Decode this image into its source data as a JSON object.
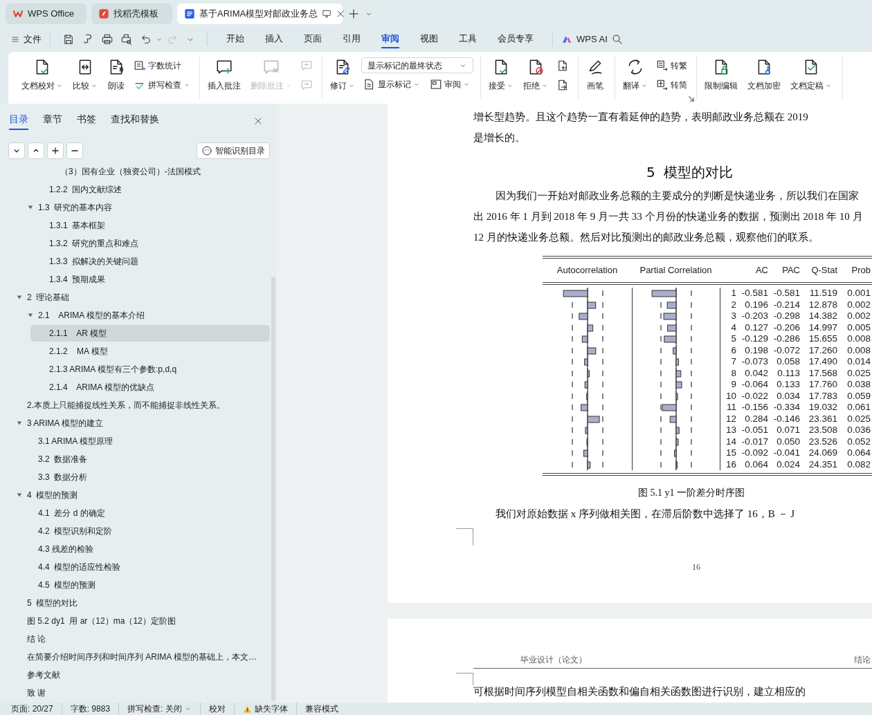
{
  "tabs": [
    {
      "label": "WPS Office",
      "kind": "wps",
      "selected": false
    },
    {
      "label": "找稻壳模板",
      "kind": "docer",
      "selected": false
    },
    {
      "label": "基于ARIMA模型对邮政业务总",
      "kind": "doc",
      "selected": true
    }
  ],
  "file_menu": {
    "label": "文件"
  },
  "quick_actions": [
    {
      "disabled": false
    },
    {
      "disabled": false
    },
    {
      "disabled": false
    },
    {
      "disabled": false
    },
    {
      "disabled": false
    },
    {
      "disabled": true
    }
  ],
  "menu_tabs": [
    {
      "label": "开始",
      "selected": false
    },
    {
      "label": "插入",
      "selected": false
    },
    {
      "label": "页面",
      "selected": false
    },
    {
      "label": "引用",
      "selected": false
    },
    {
      "label": "审阅",
      "selected": true
    },
    {
      "label": "视图",
      "selected": false
    },
    {
      "label": "工具",
      "selected": false
    },
    {
      "label": "会员专享",
      "selected": false
    }
  ],
  "ai_button": {
    "label": "WPS AI"
  },
  "ribbon": {
    "groups": [
      {
        "items": [
          {
            "kind": "large",
            "label": "文档校对",
            "caret": true,
            "disabled": false
          },
          {
            "kind": "large",
            "label": "比较",
            "caret": true,
            "disabled": false
          },
          {
            "kind": "large",
            "label": "朗读",
            "caret": false,
            "disabled": false
          },
          {
            "kind": "stack",
            "rows": [
              [
                {
                  "kind": "button",
                  "label": "字数统计",
                  "caret": false,
                  "disabled": false
                }
              ],
              [
                {
                  "kind": "button",
                  "label": "拼写检查",
                  "caret": true,
                  "disabled": false
                }
              ]
            ]
          }
        ]
      },
      {
        "items": [
          {
            "kind": "large",
            "label": "插入批注",
            "caret": false,
            "disabled": false
          },
          {
            "kind": "large",
            "label": "删除批注",
            "caret": true,
            "disabled": true
          },
          {
            "kind": "stack",
            "rows": [
              [
                {
                  "kind": "button",
                  "caret": false,
                  "disabled": true
                }
              ],
              [
                {
                  "kind": "button",
                  "caret": false,
                  "disabled": true
                }
              ]
            ]
          }
        ]
      },
      {
        "items": [
          {
            "kind": "large",
            "label": "修订",
            "caret": true,
            "disabled": false
          },
          {
            "kind": "stack",
            "rows": [
              [
                {
                  "kind": "select",
                  "value": "显示标记的最终状态"
                }
              ],
              [
                {
                  "kind": "button",
                  "label": "显示标记",
                  "caret": true,
                  "disabled": false
                },
                {
                  "kind": "button",
                  "label": "审阅",
                  "caret": true,
                  "disabled": false
                }
              ]
            ]
          }
        ]
      },
      {
        "items": [
          {
            "kind": "large",
            "label": "接受",
            "caret": true,
            "disabled": false
          },
          {
            "kind": "large",
            "label": "拒绝",
            "caret": true,
            "disabled": false
          },
          {
            "kind": "stack",
            "rows": [
              [
                {
                  "kind": "button",
                  "caret": false,
                  "disabled": false
                }
              ],
              [
                {
                  "kind": "button",
                  "caret": false,
                  "disabled": false
                }
              ]
            ]
          }
        ]
      },
      {
        "items": [
          {
            "kind": "large",
            "label": "画笔",
            "caret": false,
            "disabled": false
          }
        ]
      },
      {
        "items": [
          {
            "kind": "large",
            "label": "翻译",
            "caret": true,
            "disabled": false
          },
          {
            "kind": "stack",
            "rows": [
              [
                {
                  "kind": "button",
                  "label": "转繁",
                  "caret": false,
                  "disabled": false
                }
              ],
              [
                {
                  "kind": "button",
                  "label": "转简",
                  "caret": false,
                  "disabled": false
                }
              ]
            ]
          },
          {
            "kind": "launcher"
          }
        ]
      },
      {
        "items": [
          {
            "kind": "large",
            "label": "限制编辑",
            "caret": false,
            "disabled": false
          },
          {
            "kind": "large",
            "label": "文档加密",
            "caret": false,
            "disabled": false
          },
          {
            "kind": "large",
            "label": "文档定稿",
            "caret": true,
            "disabled": false
          }
        ]
      }
    ]
  },
  "sidebar": {
    "tabs": [
      {
        "label": "目录",
        "selected": true
      },
      {
        "label": "章节",
        "selected": false
      },
      {
        "label": "书签",
        "selected": false
      },
      {
        "label": "查找和替换",
        "selected": false
      }
    ],
    "smart_button": {
      "label": "智能识别目录"
    },
    "outline": [
      {
        "children": [
          {
            "children": [
              {
                "children": [
                  {
                    "label": "（3）国有企业（独资公司）-法国模式",
                    "selected": false
                  }
                ]
              },
              {
                "label": "1.2.2  国内文献综述",
                "selected": false
              }
            ]
          },
          {
            "label": "1.3  研究的基本内容",
            "selected": false,
            "expanded": true,
            "children": [
              {
                "label": "1.3.1  基本框架",
                "selected": false
              },
              {
                "label": "1.3.2  研究的重点和难点",
                "selected": false
              },
              {
                "label": "1.3.3  拟解决的关键问题",
                "selected": false
              },
              {
                "label": "1.3.4  预期成果",
                "selected": false
              }
            ]
          }
        ]
      },
      {
        "label": "2  理论基础",
        "selected": false,
        "expanded": true,
        "children": [
          {
            "label": "2.1    ARIMA 模型的基本介绍",
            "selected": false,
            "expanded": true,
            "children": [
              {
                "label": "2.1.1    AR 模型",
                "selected": true
              },
              {
                "label": "2.1.2    MA 模型",
                "selected": false
              },
              {
                "label": "2.1.3 ARIMA 模型有三个参数:p,d,q",
                "selected": false
              },
              {
                "label": "2.1.4    ARIMA 模型的优缺点",
                "selected": false
              }
            ]
          }
        ]
      },
      {
        "label": "2.本质上只能捕捉线性关系，而不能捕捉非线性关系。",
        "selected": false
      },
      {
        "label": "3 ARIMA 模型的建立",
        "selected": false,
        "expanded": true,
        "children": [
          {
            "label": "3.1 ARIMA 模型原理",
            "selected": false
          },
          {
            "label": "3.2  数据准备",
            "selected": false
          },
          {
            "label": "3.3  数据分析",
            "selected": false
          }
        ]
      },
      {
        "label": "4  模型的预测",
        "selected": false,
        "expanded": true,
        "children": [
          {
            "label": "4.1  差分 d 的确定",
            "selected": false
          },
          {
            "label": "4.2  模型识别和定阶",
            "selected": false
          },
          {
            "label": "4.3 残差的检验",
            "selected": false
          },
          {
            "label": "4.4  模型的适应性检验",
            "selected": false
          },
          {
            "label": "4.5  模型的预测",
            "selected": false
          }
        ]
      },
      {
        "label": "5  模型的对比",
        "selected": false
      },
      {
        "label": "图 5.2 dy1  用 ar（12）ma（12）定阶图",
        "selected": false
      },
      {
        "label": "结 论",
        "selected": false
      },
      {
        "label": "在简要介绍时间序列和时间序列 ARIMA 模型的基础上，本文…",
        "selected": false
      },
      {
        "label": "参考文献",
        "selected": false
      },
      {
        "label": "致 谢",
        "selected": false
      }
    ]
  },
  "document": {
    "pages": [
      {
        "blocks": [
          {
            "kind": "text",
            "text": "增长型趋势。且这个趋势一直有着延伸的趋势，表明邮政业务总额在 2019"
          },
          {
            "kind": "text",
            "text": "是增长的。"
          },
          {
            "kind": "heading",
            "text": "5  模型的对比"
          },
          {
            "kind": "indented_text",
            "text": "因为我们一开始对邮政业务总额的主要成分的判断是快递业务，所以我们在国家"
          },
          {
            "kind": "text",
            "text": "出 2016 年 1 月到 2018 年 9 月一共 33 个月份的快递业务的数据，预测出 2018 年 10 月"
          },
          {
            "kind": "text",
            "text": "12 月的快递业务总额。然后对比预测出的邮政业务总额，观察他们的联系。"
          },
          {
            "kind": "correlogram",
            "columns": [
              "Autocorrelation",
              "Partial Correlation",
              "AC",
              "PAC",
              "Q-Stat",
              "Prob"
            ],
            "rows": [
              {
                "lag": "1",
                "ac": "-0.581",
                "pac": "-0.581",
                "q_stat": "11.519",
                "prob": "0.001"
              },
              {
                "lag": "2",
                "ac": "0.196",
                "pac": "-0.214",
                "q_stat": "12.878",
                "prob": "0.002"
              },
              {
                "lag": "3",
                "ac": "-0.203",
                "pac": "-0.298",
                "q_stat": "14.382",
                "prob": "0.002"
              },
              {
                "lag": "4",
                "ac": "0.127",
                "pac": "-0.206",
                "q_stat": "14.997",
                "prob": "0.005"
              },
              {
                "lag": "5",
                "ac": "-0.129",
                "pac": "-0.286",
                "q_stat": "15.655",
                "prob": "0.008"
              },
              {
                "lag": "6",
                "ac": "0.198",
                "pac": "-0.072",
                "q_stat": "17.260",
                "prob": "0.008"
              },
              {
                "lag": "7",
                "ac": "-0.073",
                "pac": "0.058",
                "q_stat": "17.490",
                "prob": "0.014"
              },
              {
                "lag": "8",
                "ac": "0.042",
                "pac": "0.113",
                "q_stat": "17.568",
                "prob": "0.025"
              },
              {
                "lag": "9",
                "ac": "-0.064",
                "pac": "0.133",
                "q_stat": "17.760",
                "prob": "0.038"
              },
              {
                "lag": "10",
                "ac": "-0.022",
                "pac": "0.034",
                "q_stat": "17.783",
                "prob": "0.059"
              },
              {
                "lag": "11",
                "ac": "-0.156",
                "pac": "-0.334",
                "q_stat": "19.032",
                "prob": "0.061"
              },
              {
                "lag": "12",
                "ac": "0.284",
                "pac": "-0.146",
                "q_stat": "23.361",
                "prob": "0.025"
              },
              {
                "lag": "13",
                "ac": "-0.051",
                "pac": "0.071",
                "q_stat": "23.508",
                "prob": "0.036"
              },
              {
                "lag": "14",
                "ac": "-0.017",
                "pac": "0.050",
                "q_stat": "23.526",
                "prob": "0.052"
              },
              {
                "lag": "15",
                "ac": "-0.092",
                "pac": "-0.041",
                "q_stat": "24.069",
                "prob": "0.064"
              },
              {
                "lag": "16",
                "ac": "0.064",
                "pac": "0.024",
                "q_stat": "24.351",
                "prob": "0.082"
              }
            ]
          },
          {
            "kind": "caption",
            "text": "图 5.1 y1 一阶差分时序图"
          },
          {
            "kind": "indented_text",
            "text": "我们对原始数据 x 序列做相关图，在滞后阶数中选择了 16，B － J"
          },
          {
            "kind": "page_number",
            "text": "16"
          }
        ]
      },
      {
        "blocks": [
          {
            "kind": "header",
            "left": "毕业设计（论文）",
            "right": "结论"
          },
          {
            "kind": "text",
            "text": "可根据时间序列模型自相关函数和偏自相关函数图进行识别，建立相应的"
          }
        ]
      }
    ]
  },
  "status_bar": [
    {
      "label": "页面: 20/27",
      "kind": "text",
      "caret": false
    },
    {
      "label": "字数: 9883",
      "kind": "text",
      "caret": false
    },
    {
      "label": "拼写检查: 关闭",
      "kind": "text",
      "caret": true
    },
    {
      "label": "校对",
      "kind": "text",
      "caret": false
    },
    {
      "label": "缺失字体",
      "kind": "warning",
      "caret": false
    },
    {
      "label": "兼容模式",
      "kind": "text",
      "caret": false
    }
  ]
}
